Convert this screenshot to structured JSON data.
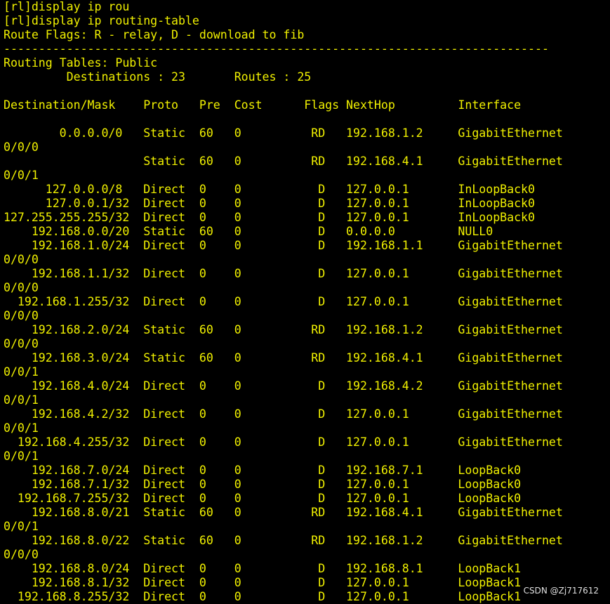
{
  "terminal": {
    "lines": [
      "[rl]display ip rou",
      "[rl]display ip routing-table",
      "Route Flags: R - relay, D - download to fib",
      "------------------------------------------------------------------------------",
      "Routing Tables: Public",
      "         Destinations : 23       Routes : 25",
      "",
      "Destination/Mask    Proto   Pre  Cost      Flags NextHop         Interface",
      "",
      "        0.0.0.0/0   Static  60   0          RD   192.168.1.2     GigabitEthernet",
      "0/0/0",
      "                    Static  60   0          RD   192.168.4.1     GigabitEthernet",
      "0/0/1",
      "      127.0.0.0/8   Direct  0    0           D   127.0.0.1       InLoopBack0",
      "      127.0.0.1/32  Direct  0    0           D   127.0.0.1       InLoopBack0",
      "127.255.255.255/32  Direct  0    0           D   127.0.0.1       InLoopBack0",
      "    192.168.0.0/20  Static  60   0           D   0.0.0.0         NULL0",
      "    192.168.1.0/24  Direct  0    0           D   192.168.1.1     GigabitEthernet",
      "0/0/0",
      "    192.168.1.1/32  Direct  0    0           D   127.0.0.1       GigabitEthernet",
      "0/0/0",
      "  192.168.1.255/32  Direct  0    0           D   127.0.0.1       GigabitEthernet",
      "0/0/0",
      "    192.168.2.0/24  Static  60   0          RD   192.168.1.2     GigabitEthernet",
      "0/0/0",
      "    192.168.3.0/24  Static  60   0          RD   192.168.4.1     GigabitEthernet",
      "0/0/1",
      "    192.168.4.0/24  Direct  0    0           D   192.168.4.2     GigabitEthernet",
      "0/0/1",
      "    192.168.4.2/32  Direct  0    0           D   127.0.0.1       GigabitEthernet",
      "0/0/1",
      "  192.168.4.255/32  Direct  0    0           D   127.0.0.1       GigabitEthernet",
      "0/0/1",
      "    192.168.7.0/24  Direct  0    0           D   192.168.7.1     LoopBack0",
      "    192.168.7.1/32  Direct  0    0           D   127.0.0.1       LoopBack0",
      "  192.168.7.255/32  Direct  0    0           D   127.0.0.1       LoopBack0",
      "    192.168.8.0/21  Static  60   0          RD   192.168.4.1     GigabitEthernet",
      "0/0/1",
      "    192.168.8.0/22  Static  60   0          RD   192.168.1.2     GigabitEthernet",
      "0/0/0",
      "    192.168.8.0/24  Direct  0    0           D   192.168.8.1     LoopBack1",
      "    192.168.8.1/32  Direct  0    0           D   127.0.0.1       LoopBack1",
      "  192.168.8.255/32  Direct  0    0           D   127.0.0.1       LoopBack1"
    ],
    "text_color": "#f0f000",
    "background": "#000000"
  },
  "watermark": {
    "text": "CSDN @Zj717612"
  }
}
